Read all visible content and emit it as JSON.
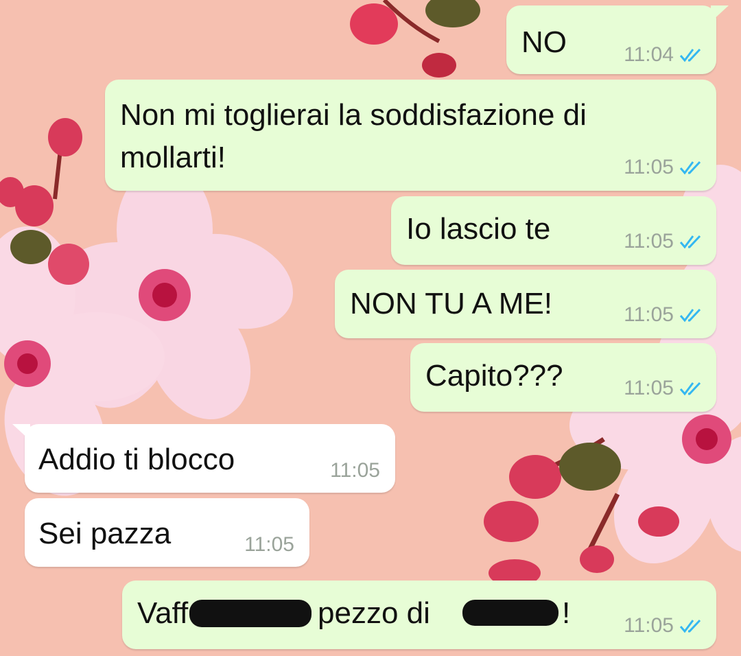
{
  "colors": {
    "outgoing_bubble": "#e7fdd6",
    "incoming_bubble": "#ffffff",
    "read_ticks": "#34b7f1",
    "wallpaper": "#f6c0b0"
  },
  "icons": {
    "read_receipt": "double-check-icon"
  },
  "messages": [
    {
      "text": "NO",
      "time": "11:04",
      "direction": "outgoing",
      "status": "read"
    },
    {
      "text_line1": "Non mi toglierai la soddisfazione di",
      "text_line2": "mollarti!",
      "time": "11:05",
      "direction": "outgoing",
      "status": "read"
    },
    {
      "text": "Io lascio te",
      "time": "11:05",
      "direction": "outgoing",
      "status": "read"
    },
    {
      "text": "NON TU A ME!",
      "time": "11:05",
      "direction": "outgoing",
      "status": "read"
    },
    {
      "text": "Capito???",
      "time": "11:05",
      "direction": "outgoing",
      "status": "read"
    },
    {
      "text": "Addio ti blocco",
      "time": "11:05",
      "direction": "incoming"
    },
    {
      "text": "Sei pazza",
      "time": "11:05",
      "direction": "incoming"
    },
    {
      "text_part1": "Vaff",
      "text_part2": "pezzo di",
      "text_part3": "!",
      "time": "11:05",
      "direction": "outgoing",
      "status": "read"
    }
  ]
}
